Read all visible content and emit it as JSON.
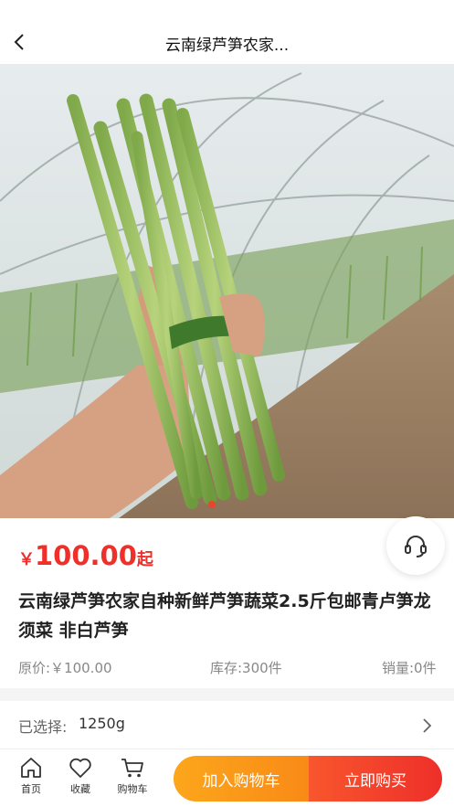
{
  "header": {
    "title": "云南绿芦笋农家...",
    "back_icon": "chevron-left-icon"
  },
  "gallery": {
    "image_alt": "Hand holding bundle of green asparagus in a greenhouse",
    "slide_count": 1,
    "active_index": 0
  },
  "product": {
    "price_symbol": "￥",
    "price": "100.00",
    "price_suffix": "起",
    "title": "云南绿芦笋农家自种新鲜芦笋蔬菜2.5斤包邮青卢笋龙须菜 非白芦笋",
    "original_price": "原价:￥100.00",
    "stock": "库存:300件",
    "sales": "销量:0件"
  },
  "spec": {
    "label": "已选择:",
    "value": "1250g"
  },
  "bottom_nav": {
    "home": "首页",
    "favorite": "收藏",
    "cart": "购物车",
    "add_to_cart": "加入购物车",
    "buy_now": "立即购买"
  },
  "colors": {
    "price_red": "#ee2f2a",
    "cart_orange": "#f98a17",
    "buy_red": "#ee2f2a"
  }
}
